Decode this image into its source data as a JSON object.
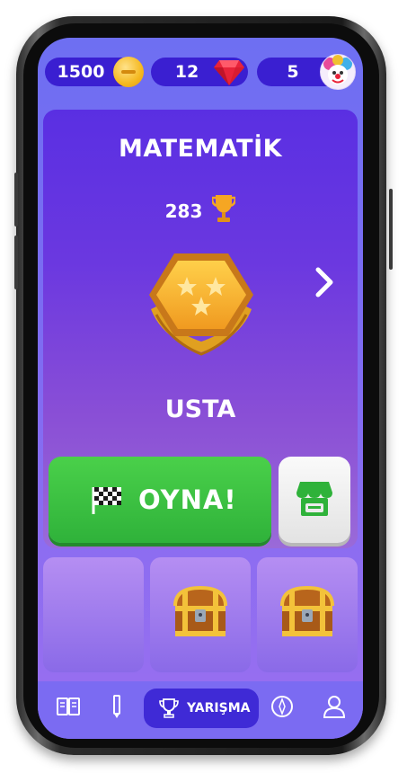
{
  "currency": {
    "coins": "1500",
    "gems": "12",
    "tickets": "5"
  },
  "card": {
    "subject": "MATEMATİK",
    "score": "283",
    "rank": "USTA",
    "play_label": "OYNA!"
  },
  "slots": [
    {
      "content": "empty"
    },
    {
      "content": "chest"
    },
    {
      "content": "chest"
    }
  ],
  "nav": {
    "active_label": "YARIŞMA",
    "items": [
      "book-icon",
      "pencil-icon",
      "trophy-icon",
      "compass-icon",
      "profile-icon"
    ]
  },
  "colors": {
    "coin": "#f5b921",
    "gem": "#e8233a",
    "play": "#3bc043",
    "nav_active": "#3f2ad6"
  }
}
